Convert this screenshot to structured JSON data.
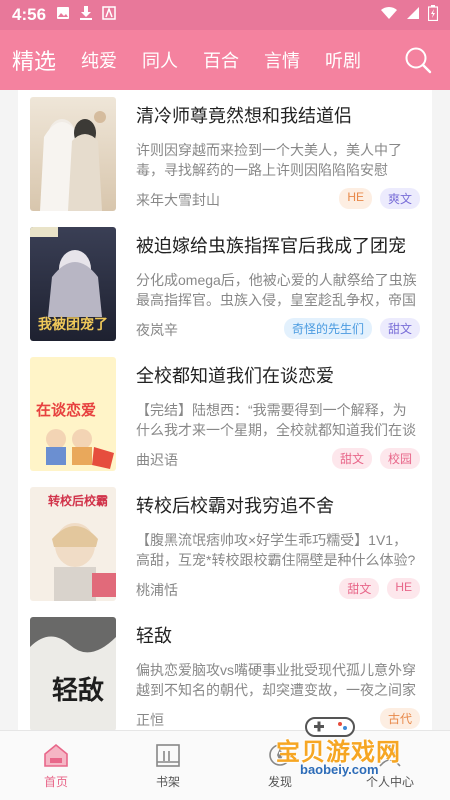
{
  "status": {
    "time": "4:56"
  },
  "top_tabs": [
    "精选",
    "纯爱",
    "同人",
    "百合",
    "言情",
    "听剧"
  ],
  "books": [
    {
      "title": "清冷师尊竟然想和我结道侣",
      "desc": "许则因穿越而来捡到一个大美人，美人中了毒，寻找解药的一路上许则因陷陷陷安慰",
      "author": "来年大雪封山",
      "tags": [
        "HE",
        "爽文"
      ],
      "cover_text": ""
    },
    {
      "title": "被迫嫁给虫族指挥官后我成了团宠",
      "desc": "分化成omega后，他被心爱的人献祭给了虫族最高指挥官。虫族入侵，皇室趁乱争权，帝国",
      "author": "夜岚辛",
      "tags": [
        "奇怪的先生们",
        "甜文"
      ],
      "cover_text": "我被团宠了"
    },
    {
      "title": "全校都知道我们在谈恋爱",
      "desc": "【完结】陆想西：“我需要得到一个解释，为什么我才来一个星期，全校就都知道我们在谈恋",
      "author": "曲迟语",
      "tags": [
        "甜文",
        "校园"
      ],
      "cover_text": "在谈恋爱"
    },
    {
      "title": "转校后校霸对我穷追不舍",
      "desc": "【腹黑流氓痞帅攻×好学生乖巧糯受】1V1，高甜，互宠*转校跟校霸住隔壁是种什么体验?",
      "author": "桃浦恬",
      "tags": [
        "甜文",
        "HE"
      ],
      "cover_text": "转校后校霸"
    },
    {
      "title": "轻敌",
      "desc": "偏执恋爱脑攻vs嘴硬事业批受现代孤儿意外穿越到不知名的朝代，却突遭变故，一夜之间家",
      "author": "正恒",
      "tags": [
        "古代"
      ],
      "cover_text": "轻敌"
    }
  ],
  "bottom_nav": [
    "首页",
    "书架",
    "发现",
    "个人中心"
  ],
  "watermark": {
    "text": "宝贝游戏网",
    "url": "baobeiy.com"
  },
  "colors": {
    "accent": "#f4829f",
    "status_bar": "#e8789a"
  }
}
